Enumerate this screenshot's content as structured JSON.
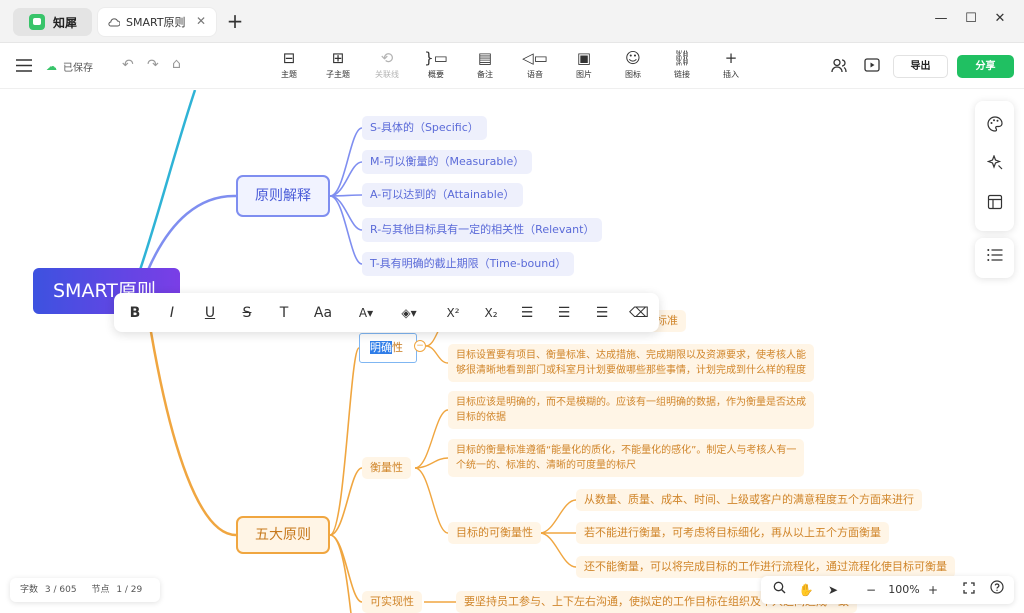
{
  "titlebar": {
    "app_name": "知犀",
    "doc_tab": "SMART原则",
    "close_tab": "✕",
    "new_tab": "+",
    "minimize": "—",
    "maximize": "☐",
    "close": "✕"
  },
  "toolbar": {
    "saved_label": "已保存",
    "items": [
      {
        "label": "主题",
        "icon": "⊟"
      },
      {
        "label": "子主题",
        "icon": "⊞"
      },
      {
        "label": "关联线",
        "icon": "⟲"
      },
      {
        "label": "概要",
        "icon": "}▭"
      },
      {
        "label": "备注",
        "icon": "▤"
      },
      {
        "label": "语音",
        "icon": "◁▭"
      },
      {
        "label": "图片",
        "icon": "▣"
      },
      {
        "label": "图标",
        "icon": "☺"
      },
      {
        "label": "链接",
        "icon": "⛓"
      },
      {
        "label": "插入",
        "icon": "+"
      }
    ],
    "export_label": "导出",
    "share_label": "分享"
  },
  "mindmap": {
    "root": "SMART原则",
    "branch1": {
      "label": "原则解释",
      "leaves": [
        "S-具体的（Specific）",
        "M-可以衡量的（Measurable）",
        "A-可以达到的（Attainable）",
        "R-与其他目标具有一定的相关性（Relevant）",
        "T-具有明确的截止期限（Time-bound）"
      ]
    },
    "branch2": {
      "label": "五大原则",
      "selected_node": {
        "highlight": "明确",
        "rest": "性",
        "collapse": "−"
      },
      "clarity_partial": "标准",
      "clarity_detail": [
        "目标设置要有项目、衡量标准、达成措施、完成期限以及资源要求，使考核人能",
        "够很清晰地看到部门或科室月计划要做哪些那些事情，计划完成到什么样的程度"
      ],
      "measurable_label": "衡量性",
      "measurable_detail1": [
        "目标应该是明确的，而不是模糊的。应该有一组明确的数据，作为衡量是否达成",
        "目标的依据"
      ],
      "measurable_detail2": [
        "目标的衡量标准遵循“能量化的质化，不能量化的感化”。制定人与考核人有一",
        "个统一的、标准的、清晰的可度量的标尺"
      ],
      "measurable_sub": "目标的可衡量性",
      "measurable_sub_items": [
        "从数量、质量、成本、时间、上级或客户的满意程度五个方面来进行",
        "若不能进行衡量，可考虑将目标细化，再从以上五个方面衡量",
        "还不能衡量，可以将完成目标的工作进行流程化，通过流程化使目标可衡量"
      ],
      "attainable_label": "可实现性",
      "attainable_detail": "要坚持员工参与、上下左右沟通，使拟定的工作目标在组织及个人之间达成一致"
    }
  },
  "format_toolbar": {
    "buttons": [
      {
        "name": "bold-button",
        "glyph": "B"
      },
      {
        "name": "italic-button",
        "glyph": "I"
      },
      {
        "name": "underline-button",
        "glyph": "U"
      },
      {
        "name": "strikethrough-button",
        "glyph": "S"
      },
      {
        "name": "text-style-button",
        "glyph": "T"
      },
      {
        "name": "font-size-button",
        "glyph": "Aa"
      },
      {
        "name": "font-color-button",
        "glyph": "A▾"
      },
      {
        "name": "fill-color-button",
        "glyph": "◈▾"
      },
      {
        "name": "superscript-button",
        "glyph": "X²"
      },
      {
        "name": "subscript-button",
        "glyph": "X₂"
      },
      {
        "name": "align-left-button",
        "glyph": "☰"
      },
      {
        "name": "align-center-button",
        "glyph": "☰"
      },
      {
        "name": "align-right-button",
        "glyph": "☰"
      },
      {
        "name": "clear-format-button",
        "glyph": "⌫"
      }
    ]
  },
  "statusbar": {
    "word_label": "字数",
    "word_count": "3 / 605",
    "node_label": "节点",
    "node_count": "1 / 29"
  },
  "zoom": {
    "level": "100%",
    "minus": "−",
    "plus": "+"
  },
  "colors": {
    "accent_green": "#20c062",
    "blue_branch": "#7f8ef0",
    "orange_branch": "#f0a640",
    "cyan_line": "#2fb3d6"
  }
}
